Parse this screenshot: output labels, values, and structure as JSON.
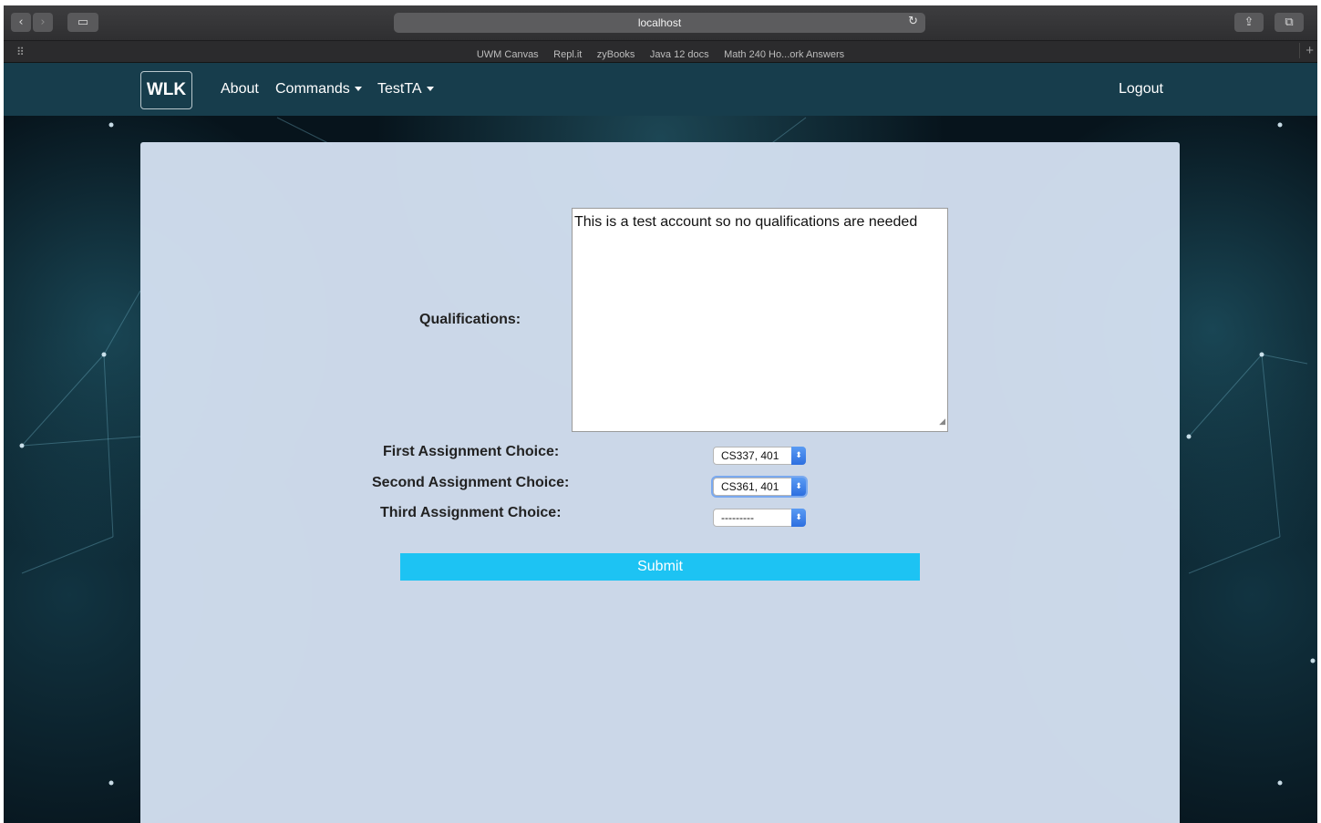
{
  "browser": {
    "url": "localhost",
    "favorites": [
      "UWM Canvas",
      "Repl.it",
      "zyBooks",
      "Java 12 docs",
      "Math 240 Ho...ork Answers"
    ]
  },
  "navbar": {
    "brand": "WLK",
    "links": [
      "About",
      "Commands",
      "TestTA"
    ],
    "logout": "Logout"
  },
  "form": {
    "qualifications_label": "Qualifications:",
    "qualifications_value": "This is a test account so no qualifications are needed",
    "first_label": "First Assignment Choice:",
    "first_value": "CS337, 401",
    "second_label": "Second Assignment Choice:",
    "second_value": "CS361, 401",
    "third_label": "Third Assignment Choice:",
    "third_value": "---------",
    "submit_label": "Submit"
  },
  "colors": {
    "navbar": "#173d4c",
    "submit": "#1dc3f3",
    "card": "#d3e0f0"
  }
}
